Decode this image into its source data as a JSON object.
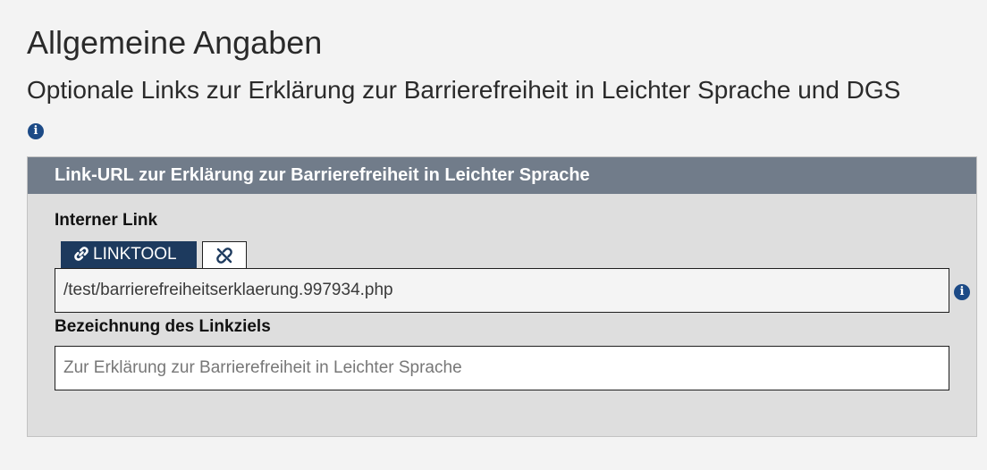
{
  "page": {
    "title": "Allgemeine Angaben",
    "subtitle": "Optionale Links zur Erklärung zur Barrierefreiheit in Leichter Sprache und DGS",
    "info_glyph": "i"
  },
  "panel": {
    "header": "Link-URL zur Erklärung zur Barrierefreiheit in Leichter Sprache",
    "internal_link": {
      "label": "Interner Link",
      "linktool_button": "LINKTOOL",
      "linktool_icon": "link-icon",
      "unlink_icon": "unlink-icon",
      "url_value": "/test/barrierefreiheitserklaerung.997934.php"
    },
    "link_target": {
      "label": "Bezeichnung des Linkziels",
      "value": "",
      "placeholder": "Zur Erklärung zur Barrierefreiheit in Leichter Sprache"
    }
  },
  "colors": {
    "page_background": "#f3f3f3",
    "panel_header": "#717c8a",
    "panel_body": "#dedede",
    "linktool_button": "#1d3a5e",
    "info_icon": "#1c4a86"
  }
}
